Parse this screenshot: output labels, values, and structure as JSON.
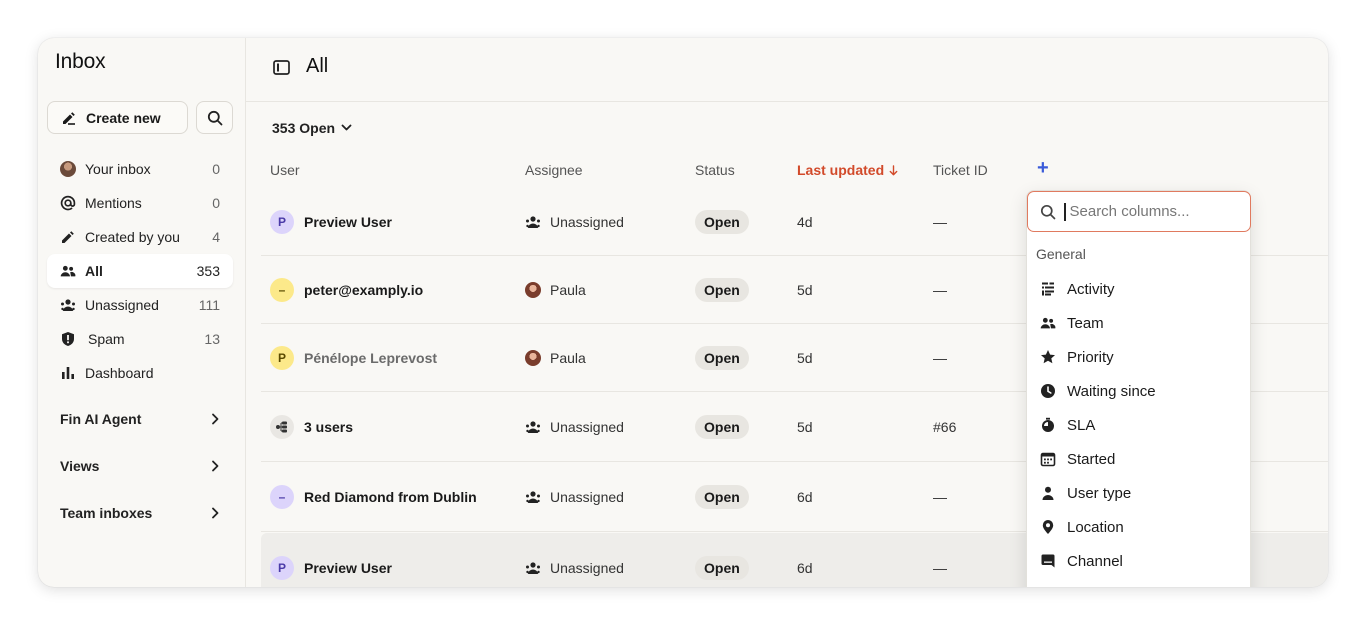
{
  "sidebar": {
    "title": "Inbox",
    "create_label": "Create new",
    "items": [
      {
        "label": "Your inbox",
        "count": "0",
        "icon": "avatar"
      },
      {
        "label": "Mentions",
        "count": "0",
        "icon": "at-icon"
      },
      {
        "label": "Created by you",
        "count": "4",
        "icon": "pencil-icon"
      },
      {
        "label": "All",
        "count": "353",
        "icon": "users-icon",
        "active": true
      },
      {
        "label": "Unassigned",
        "count": "111",
        "icon": "unassigned-icon"
      },
      {
        "label": "Spam",
        "count": "13",
        "icon": "shield-alert-icon"
      },
      {
        "label": "Dashboard",
        "count": "",
        "icon": "bar-chart-icon"
      }
    ],
    "sections": [
      "Fin AI Agent",
      "Views",
      "Team inboxes"
    ]
  },
  "main": {
    "title": "All",
    "open_filter": "353 Open",
    "columns": {
      "user": "User",
      "assignee": "Assignee",
      "status": "Status",
      "last_updated": "Last updated",
      "ticket_id": "Ticket ID"
    },
    "rows": [
      {
        "avatar": "P",
        "avatar_color": "purple",
        "user": "Preview User",
        "assignee": "Unassigned",
        "status": "Open",
        "updated": "4d",
        "ticket": "—"
      },
      {
        "avatar": "–",
        "avatar_color": "yellow",
        "user": "peter@examply.io",
        "assignee": "Paula",
        "status": "Open",
        "updated": "5d",
        "ticket": "—"
      },
      {
        "avatar": "P",
        "avatar_color": "yellow",
        "user": "Pénélope Leprevost",
        "assignee": "Paula",
        "status": "Open",
        "updated": "5d",
        "ticket": "—"
      },
      {
        "avatar": "",
        "avatar_color": "gray",
        "user": "3 users",
        "assignee": "Unassigned",
        "status": "Open",
        "updated": "5d",
        "ticket": "#66"
      },
      {
        "avatar": "–",
        "avatar_color": "purple",
        "user": "Red Diamond from Dublin",
        "assignee": "Unassigned",
        "status": "Open",
        "updated": "6d",
        "ticket": "—"
      },
      {
        "avatar": "P",
        "avatar_color": "purple",
        "user": "Preview User",
        "assignee": "Unassigned",
        "status": "Open",
        "updated": "6d",
        "ticket": "—"
      }
    ]
  },
  "column_picker": {
    "search_placeholder": "Search columns...",
    "group": "General",
    "items": [
      {
        "label": "Activity",
        "icon": "activity-icon"
      },
      {
        "label": "Team",
        "icon": "team-icon"
      },
      {
        "label": "Priority",
        "icon": "star-icon"
      },
      {
        "label": "Waiting since",
        "icon": "clock-icon"
      },
      {
        "label": "SLA",
        "icon": "sla-icon"
      },
      {
        "label": "Started",
        "icon": "calendar-icon"
      },
      {
        "label": "User type",
        "icon": "person-icon"
      },
      {
        "label": "Location",
        "icon": "pin-icon"
      },
      {
        "label": "Channel",
        "icon": "chat-icon"
      }
    ]
  },
  "colors": {
    "accent": "#d24a2a",
    "plus": "#3a5bd9",
    "focus_border": "#e07a5f"
  }
}
